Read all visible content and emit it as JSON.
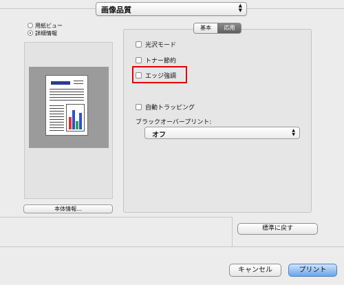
{
  "popup": {
    "value": "画像品質"
  },
  "left": {
    "radios": [
      {
        "label": "用紙ビュー",
        "selected": false
      },
      {
        "label": "詳細情報",
        "selected": true
      }
    ],
    "device_info_button": "本体情報..."
  },
  "tabs": [
    {
      "label": "基本",
      "active": false
    },
    {
      "label": "応用",
      "active": true
    }
  ],
  "options": {
    "gloss_mode": "光沢モード",
    "toner_save": "トナー節約",
    "edge_enhance": "エッジ強調",
    "auto_trapping": "自動トラッピング",
    "black_overprint_label": "ブラックオーバープリント:",
    "black_overprint_value": "オフ"
  },
  "restore_defaults": "標準に戻す",
  "footer": {
    "cancel": "キャンセル",
    "print": "プリント"
  },
  "colors": {
    "highlight": "#e00000",
    "primary_button": "#6aa5ea"
  }
}
